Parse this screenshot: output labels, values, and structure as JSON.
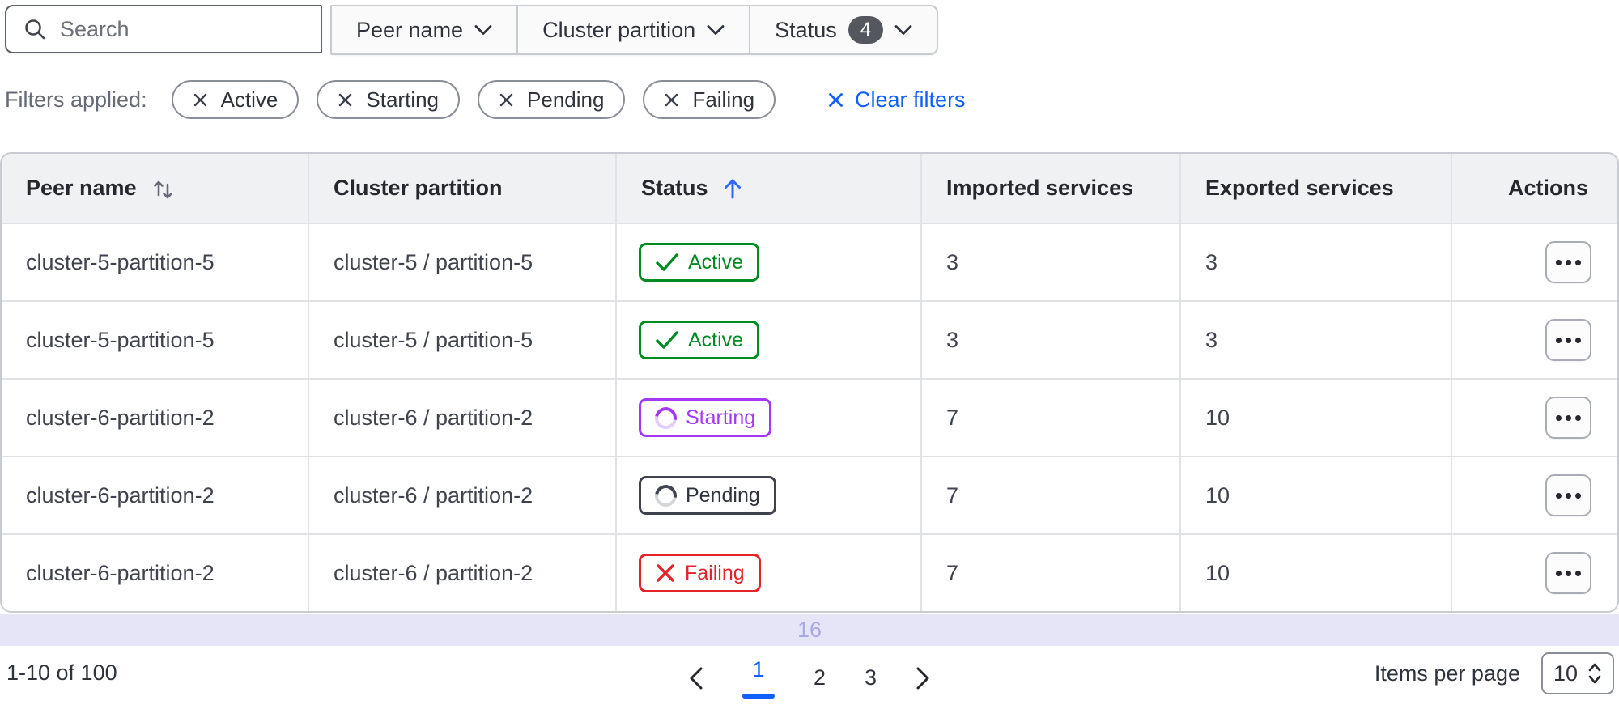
{
  "toolbar": {
    "search_placeholder": "Search",
    "dropdowns": [
      {
        "label": "Peer name"
      },
      {
        "label": "Cluster partition"
      },
      {
        "label": "Status",
        "count": "4"
      }
    ]
  },
  "filters": {
    "label": "Filters applied:",
    "chips": [
      "Active",
      "Starting",
      "Pending",
      "Failing"
    ],
    "clear_label": "Clear filters"
  },
  "table": {
    "columns": [
      "Peer name",
      "Cluster partition",
      "Status",
      "Imported services",
      "Exported services",
      "Actions"
    ],
    "sort": {
      "peer_name": "sortable-unsorted",
      "status": "ascending"
    },
    "rows": [
      {
        "peer_name": "cluster-5-partition-5",
        "cluster_partition": "cluster-5 / partition-5",
        "status": "Active",
        "imported": "3",
        "exported": "3"
      },
      {
        "peer_name": "cluster-5-partition-5",
        "cluster_partition": "cluster-5 / partition-5",
        "status": "Active",
        "imported": "3",
        "exported": "3"
      },
      {
        "peer_name": "cluster-6-partition-2",
        "cluster_partition": "cluster-6 / partition-2",
        "status": "Starting",
        "imported": "7",
        "exported": "10"
      },
      {
        "peer_name": "cluster-6-partition-2",
        "cluster_partition": "cluster-6 / partition-2",
        "status": "Pending",
        "imported": "7",
        "exported": "10"
      },
      {
        "peer_name": "cluster-6-partition-2",
        "cluster_partition": "cluster-6 / partition-2",
        "status": "Failing",
        "imported": "7",
        "exported": "10"
      }
    ]
  },
  "slide_marker": {
    "number": "16"
  },
  "pagination": {
    "range_label": "1-10 of 100",
    "pages": [
      "1",
      "2",
      "3"
    ],
    "current_page": "1",
    "items_per_page_label": "Items per page",
    "items_per_page_value": "10"
  },
  "colors": {
    "accent_blue": "#1060ff",
    "status_active_green": "#008a22",
    "status_starting_purple": "#a437f5",
    "status_pending_gray": "#3f434d",
    "status_failing_red": "#e5232b",
    "header_bg": "#f0f1f3",
    "slide_marker_bg": "#e6e5f7"
  }
}
